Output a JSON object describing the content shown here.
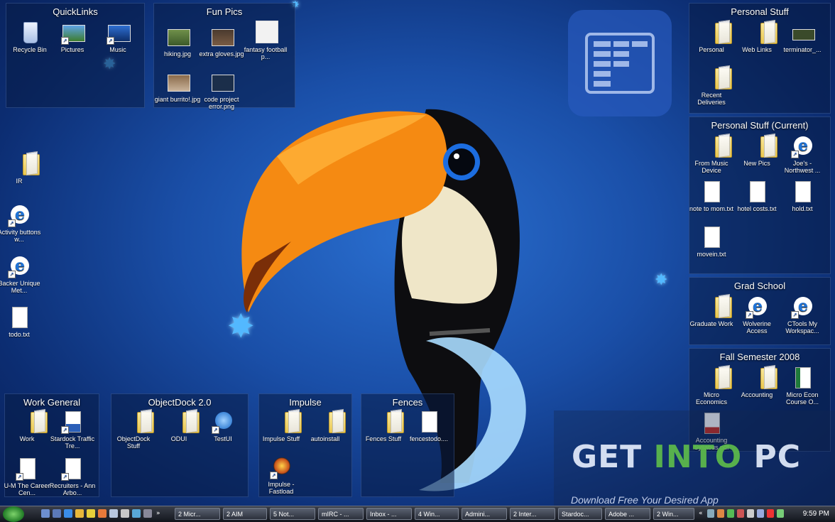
{
  "fences": {
    "quicklinks": {
      "title": "QuickLinks",
      "items": [
        {
          "label": "Recycle Bin",
          "icon": "recycle-bin-icon"
        },
        {
          "label": "Pictures",
          "icon": "pictures-icon"
        },
        {
          "label": "Music",
          "icon": "music-icon"
        }
      ]
    },
    "funpics": {
      "title": "Fun Pics",
      "items": [
        {
          "label": "hiking.jpg"
        },
        {
          "label": "extra gloves.jpg"
        },
        {
          "label": "fantasy football p..."
        },
        {
          "label": "giant burrito!.jpg"
        },
        {
          "label": "code project error.png"
        }
      ]
    },
    "personal": {
      "title": "Personal Stuff",
      "items": [
        {
          "label": "Personal"
        },
        {
          "label": "Web Links"
        },
        {
          "label": "terminator_..."
        },
        {
          "label": "Recent Deliveries"
        }
      ]
    },
    "personal_current": {
      "title": "Personal Stuff (Current)",
      "items": [
        {
          "label": "From Music Device"
        },
        {
          "label": "New Pics"
        },
        {
          "label": "Joe's - Northwest ..."
        },
        {
          "label": "note to mom.txt"
        },
        {
          "label": "hotel costs.txt"
        },
        {
          "label": "hold.txt"
        },
        {
          "label": "movein.txt"
        }
      ]
    },
    "grad": {
      "title": "Grad School",
      "items": [
        {
          "label": "Graduate Work"
        },
        {
          "label": "Wolverine Access"
        },
        {
          "label": "CTools My Workspac..."
        }
      ]
    },
    "fall": {
      "title": "Fall Semester 2008",
      "items": [
        {
          "label": "Micro Economics"
        },
        {
          "label": "Accounting"
        },
        {
          "label": "Micro Econ Course O..."
        },
        {
          "label": "Accounting Syllabus.pdf"
        }
      ]
    },
    "work": {
      "title": "Work General",
      "items": [
        {
          "label": "Work"
        },
        {
          "label": "Stardock Traffic Tre..."
        },
        {
          "label": "U-M The Career Cen..."
        },
        {
          "label": "Recruiters - Ann Arbo..."
        }
      ]
    },
    "objectdock": {
      "title": "ObjectDock 2.0",
      "items": [
        {
          "label": "ObjectDock Stuff"
        },
        {
          "label": "ODUI"
        },
        {
          "label": "TestUI"
        }
      ]
    },
    "impulse": {
      "title": "Impulse",
      "items": [
        {
          "label": "Impulse Stuff"
        },
        {
          "label": "autoinstall"
        },
        {
          "label": "Impulse -Fastload"
        }
      ]
    },
    "fencesf": {
      "title": "Fences",
      "items": [
        {
          "label": "Fences Stuff"
        },
        {
          "label": "fencestodo...."
        }
      ]
    }
  },
  "desktop_icons": [
    {
      "label": "IR"
    },
    {
      "label": "Activity buttons w..."
    },
    {
      "label": "Backer Unique Met..."
    },
    {
      "label": "todo.txt"
    }
  ],
  "taskbar": {
    "buttons": [
      {
        "label": "2 Micr..."
      },
      {
        "label": "2 AIM"
      },
      {
        "label": "5 Not..."
      },
      {
        "label": "mIRC - ..."
      },
      {
        "label": "Inbox - ..."
      },
      {
        "label": "4 Win..."
      },
      {
        "label": "Admini..."
      },
      {
        "label": "2 Inter..."
      },
      {
        "label": "Stardoc..."
      },
      {
        "label": "Adobe ..."
      },
      {
        "label": "2 Win..."
      }
    ],
    "clock": "9:59 PM"
  },
  "watermark": {
    "get": "GET ",
    "into": "INTO",
    "pc": " PC",
    "tagline": "Download Free Your Desired App"
  },
  "colors": {
    "fence_bg": "#081c46",
    "accent": "#53b8ff",
    "toucan_beak": "#f58a12"
  }
}
